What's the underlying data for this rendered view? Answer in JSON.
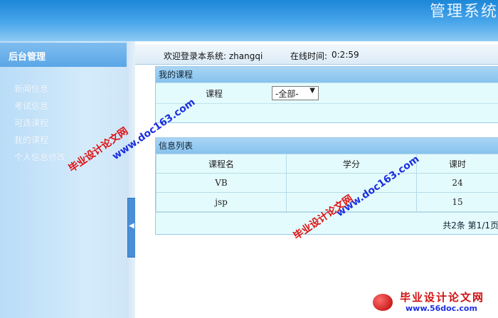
{
  "banner": {
    "title": "管理系统"
  },
  "sidebar": {
    "header": "后台管理",
    "items": [
      {
        "label": "新闻信息"
      },
      {
        "label": "考试信息"
      },
      {
        "label": "可选课程"
      },
      {
        "label": "我的课程"
      },
      {
        "label": "个人信息修改"
      }
    ]
  },
  "topbar": {
    "welcome": "欢迎登录本系统: zhangqi",
    "online_label": "在线时间:",
    "online_value": "0:2:59"
  },
  "my_courses": {
    "title": "我的课程",
    "filter_label": "课程",
    "filter_value": "-全部-"
  },
  "info_list": {
    "title": "信息列表",
    "columns": [
      "课程名",
      "学分",
      "课时"
    ],
    "rows": [
      {
        "name": "VB",
        "credit": "",
        "hours": "24"
      },
      {
        "name": "jsp",
        "credit": "",
        "hours": "15"
      }
    ],
    "pager": "共2条  第1/1页"
  },
  "watermarks": {
    "cn": "毕业设计论文网",
    "url": "www.doc163.com",
    "bottom_cn": "毕业设计论文网",
    "bottom_url": "www.56doc.com"
  },
  "icons": {
    "collapse": "triangle-left-icon",
    "dropdown": "triangle-down-icon"
  }
}
